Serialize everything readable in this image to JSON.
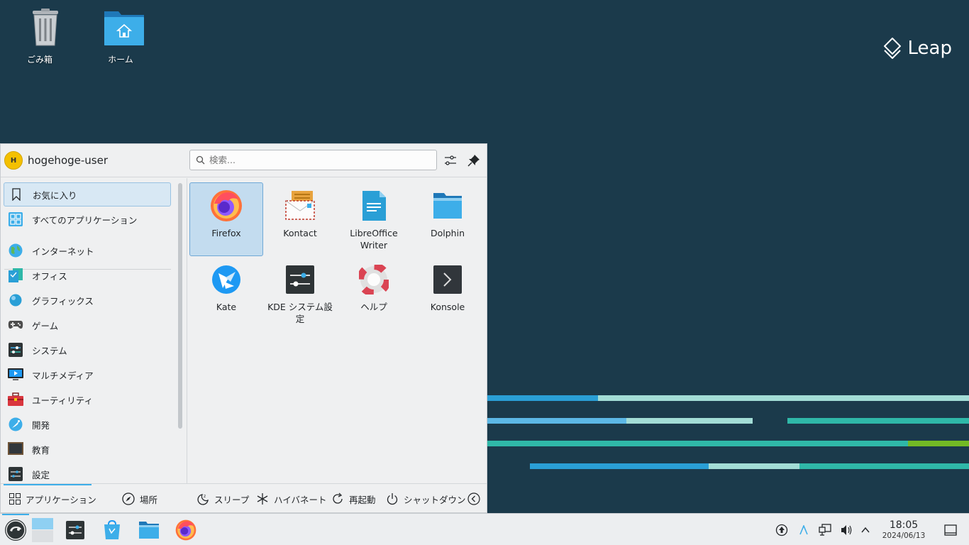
{
  "desktop": {
    "icons": [
      {
        "label": "ごみ箱",
        "icon": "trash-icon"
      },
      {
        "label": "ホーム",
        "icon": "home-folder-icon"
      }
    ],
    "brand": "Leap"
  },
  "launcher": {
    "user": {
      "initial": "H",
      "name": "hogehoge-user"
    },
    "search": {
      "placeholder": "検索..."
    },
    "categories": [
      {
        "label": "お気に入り",
        "icon": "bookmark-icon",
        "selected": true
      },
      {
        "label": "すべてのアプリケーション",
        "icon": "grid-icon"
      },
      {
        "label": "インターネット",
        "icon": "globe-icon"
      },
      {
        "label": "オフィス",
        "icon": "office-icon"
      },
      {
        "label": "グラフィックス",
        "icon": "graphics-icon"
      },
      {
        "label": "ゲーム",
        "icon": "gamepad-icon"
      },
      {
        "label": "システム",
        "icon": "system-icon"
      },
      {
        "label": "マルチメディア",
        "icon": "multimedia-icon"
      },
      {
        "label": "ユーティリティ",
        "icon": "toolbox-icon"
      },
      {
        "label": "開発",
        "icon": "development-icon"
      },
      {
        "label": "教育",
        "icon": "education-icon"
      },
      {
        "label": "設定",
        "icon": "settings-icon"
      }
    ],
    "apps": [
      {
        "label": "Firefox",
        "icon": "firefox-icon",
        "selected": true
      },
      {
        "label": "Kontact",
        "icon": "kontact-icon"
      },
      {
        "label": "LibreOffice Writer",
        "icon": "writer-icon"
      },
      {
        "label": "Dolphin",
        "icon": "dolphin-icon"
      },
      {
        "label": "Kate",
        "icon": "kate-icon"
      },
      {
        "label": "KDE システム設定",
        "icon": "system-settings-icon"
      },
      {
        "label": "ヘルプ",
        "icon": "help-icon"
      },
      {
        "label": "Konsole",
        "icon": "konsole-icon"
      }
    ],
    "footer": {
      "applications": "アプリケーション",
      "places": "場所",
      "sleep": "スリープ",
      "hibernate": "ハイバネート",
      "restart": "再起動",
      "shutdown": "シャットダウン"
    }
  },
  "taskbar": {
    "time": "18:05",
    "date": "2024/06/13"
  },
  "colors": {
    "desktop_bg": "#1b3a4b",
    "accent": "#3daee9",
    "selection": "#c3dcef",
    "stripe_teal": "#2fb8a8",
    "stripe_light": "#a3ddd6",
    "stripe_green": "#73ba25"
  }
}
